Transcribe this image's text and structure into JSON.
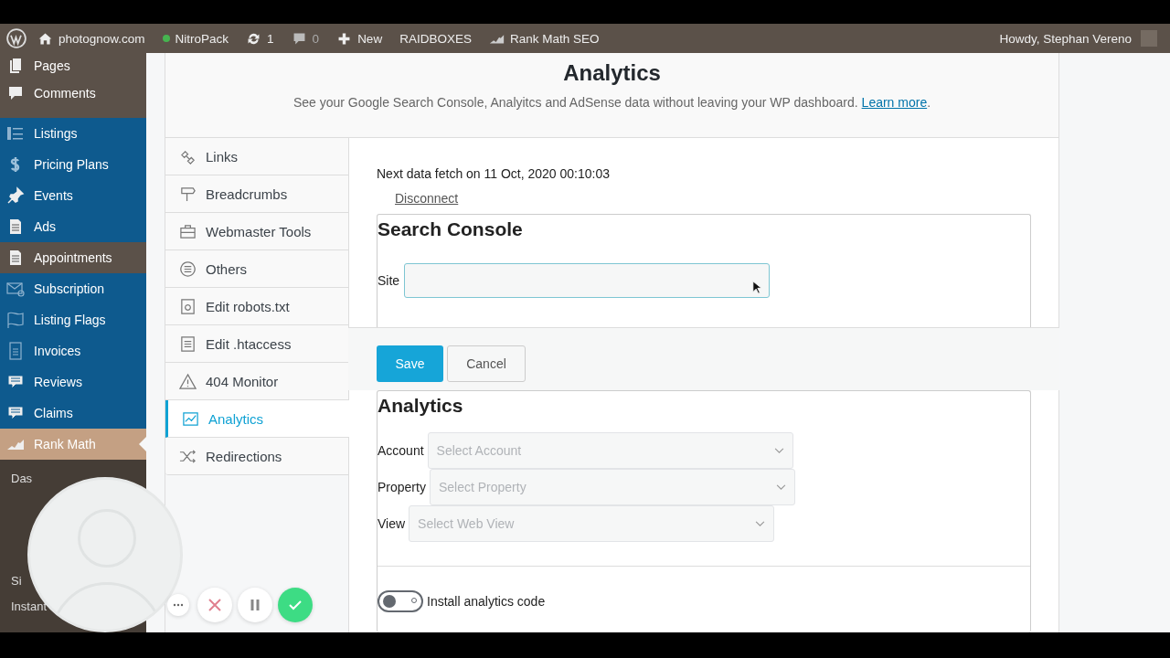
{
  "admin_bar": {
    "items": [
      {
        "kind": "home",
        "label": "photognow.com"
      },
      {
        "kind": "status",
        "label": "NitroPack"
      },
      {
        "kind": "updates",
        "label": "1"
      },
      {
        "kind": "comments",
        "label": "0"
      },
      {
        "kind": "new",
        "label": "New"
      },
      {
        "kind": "text",
        "label": "RAIDBOXES"
      },
      {
        "kind": "rankmath",
        "label": "Rank Math SEO"
      }
    ],
    "account": "Howdy, Stephan Vereno"
  },
  "sidebar": {
    "items": [
      {
        "label": "Pages",
        "color": "#5b5149",
        "selected": false
      },
      {
        "label": "Comments",
        "color": "#5b5149",
        "selected": false
      },
      {
        "label": "Listings",
        "color": "#0e5a8e",
        "selected": false
      },
      {
        "label": "Pricing Plans",
        "color": "#0e5a8e",
        "selected": false
      },
      {
        "label": "Events",
        "color": "#0e5a8e",
        "selected": false
      },
      {
        "label": "Ads",
        "color": "#0e5a8e",
        "selected": false
      },
      {
        "label": "Appointments",
        "color": "#5b5149",
        "selected": false
      },
      {
        "label": "Subscription",
        "color": "#0e5a8e",
        "selected": false
      },
      {
        "label": "Listing Flags",
        "color": "#0e5a8e",
        "selected": false
      },
      {
        "label": "Invoices",
        "color": "#0e5a8e",
        "selected": false
      },
      {
        "label": "Reviews",
        "color": "#0e5a8e",
        "selected": false
      },
      {
        "label": "Claims",
        "color": "#0e5a8e",
        "selected": false
      },
      {
        "label": "Rank Math",
        "color": "#c4a083",
        "selected": true
      }
    ],
    "submenu": [
      "Das",
      "Si",
      "Instant"
    ]
  },
  "header": {
    "title": "Analytics",
    "description": "See your Google Search Console, Analyitcs and AdSense data without leaving your WP dashboard.",
    "link": "Learn more",
    "after_link": "."
  },
  "tabs": [
    {
      "label": "Links",
      "selected": false
    },
    {
      "label": "Breadcrumbs",
      "selected": false
    },
    {
      "label": "Webmaster Tools",
      "selected": false
    },
    {
      "label": "Others",
      "selected": false
    },
    {
      "label": "Edit robots.txt",
      "selected": false
    },
    {
      "label": "Edit .htaccess",
      "selected": false
    },
    {
      "label": "404 Monitor",
      "selected": false
    },
    {
      "label": "Analytics",
      "selected": true
    },
    {
      "label": "Redirections",
      "selected": false
    }
  ],
  "next_fetch": "Next data fetch on 11 Oct, 2020 00:10:03",
  "disconnect": "Disconnect",
  "search_console": {
    "title": "Search Console",
    "site_label": "Site"
  },
  "buttons": {
    "save": "Save",
    "cancel": "Cancel"
  },
  "analytics": {
    "title": "Analytics",
    "fields": [
      {
        "label": "Account",
        "placeholder": "Select Account"
      },
      {
        "label": "Property",
        "placeholder": "Select Property"
      },
      {
        "label": "View",
        "placeholder": "Select Web View"
      }
    ],
    "toggle": {
      "label": "Install analytics code",
      "on": false
    }
  }
}
